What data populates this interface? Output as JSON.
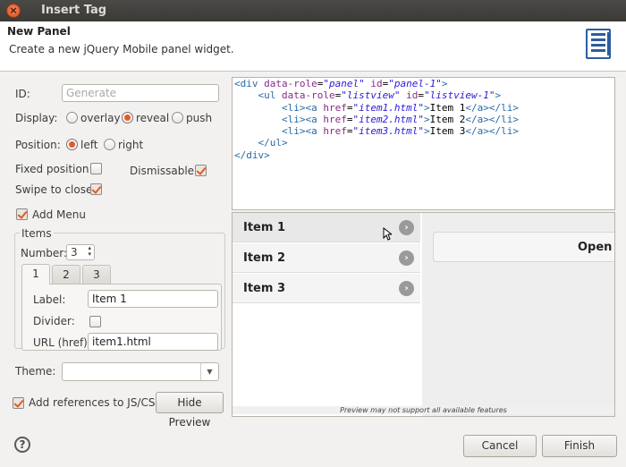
{
  "window": {
    "title": "Insert Tag"
  },
  "header": {
    "title": "New Panel",
    "description": "Create a new jQuery Mobile panel widget.",
    "icon": "panel-wizard-icon"
  },
  "form": {
    "id_label": "ID:",
    "id_placeholder": "Generate",
    "display_label": "Display:",
    "display_options": [
      "overlay",
      "reveal",
      "push"
    ],
    "display_selected": "reveal",
    "position_label": "Position:",
    "position_options": [
      "left",
      "right"
    ],
    "position_selected": "left",
    "fixed_label": "Fixed position:",
    "fixed_checked": false,
    "dismissable_label": "Dismissable:",
    "dismissable_checked": true,
    "swipe_label": "Swipe to close:",
    "swipe_checked": true,
    "add_menu_label": "Add Menu",
    "add_menu_checked": true,
    "items_group_label": "Items",
    "number_label": "Number:",
    "number_value": "3",
    "tabs": [
      "1",
      "2",
      "3"
    ],
    "active_tab": "1",
    "item_label_label": "Label:",
    "item_label_value": "Item 1",
    "divider_label": "Divider:",
    "divider_checked": false,
    "url_label": "URL (href):",
    "url_value": "item1.html",
    "theme_label": "Theme:",
    "theme_value": "",
    "add_refs_label": "Add references to JS/CSS",
    "add_refs_checked": true,
    "hide_preview_label": "Hide Preview"
  },
  "code": {
    "lines": [
      "<div data-role=\"panel\" id=\"panel-1\">",
      "    <ul data-role=\"listview\" id=\"listview-1\">",
      "        <li><a href=\"item1.html\">Item 1</a></li>",
      "        <li><a href=\"item2.html\">Item 2</a></li>",
      "        <li><a href=\"item3.html\">Item 3</a></li>",
      "    </ul>",
      "</div>"
    ]
  },
  "preview": {
    "items": [
      "Item 1",
      "Item 2",
      "Item 3"
    ],
    "open_button": "Open",
    "note": "Preview may not support all available features"
  },
  "footer": {
    "cancel_label": "Cancel",
    "finish_label": "Finish"
  },
  "colors": {
    "accent": "#e05a2b",
    "dialog_bg": "#f2f1f0",
    "titlebar_bg": "#3b3a37"
  }
}
